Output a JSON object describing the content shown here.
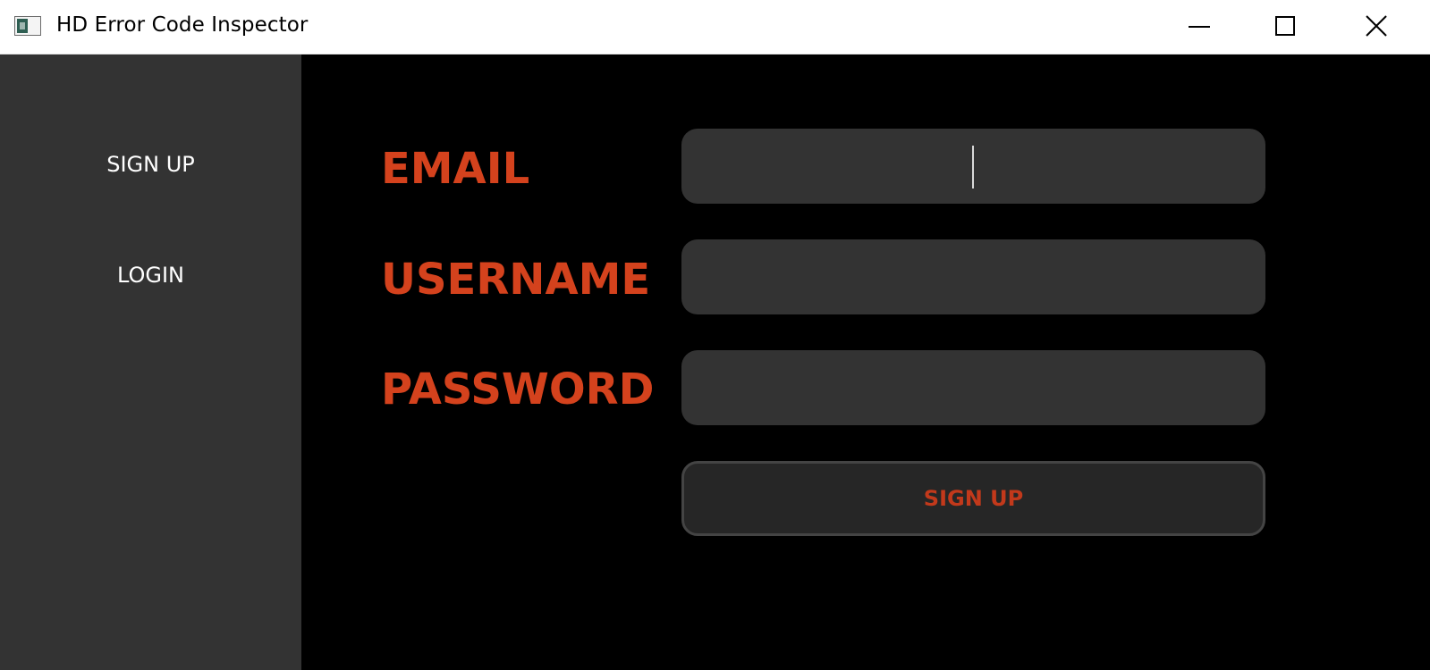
{
  "window": {
    "title": "HD Error Code Inspector",
    "app_icon": "app-window-icon",
    "controls": {
      "minimize_icon": "minimize-icon",
      "maximize_icon": "maximize-icon",
      "close_icon": "close-icon"
    }
  },
  "sidebar": {
    "items": [
      {
        "label": "SIGN UP"
      },
      {
        "label": "LOGIN"
      }
    ]
  },
  "form": {
    "email_label": "EMAIL",
    "username_label": "USERNAME",
    "password_label": "PASSWORD",
    "email_value": "",
    "username_value": "",
    "password_value": "",
    "submit_label": "SIGN UP"
  },
  "colors": {
    "accent": "#d4421d",
    "sidebar_bg": "#333333",
    "main_bg": "#000000",
    "field_bg": "#333333",
    "button_bg": "#262626"
  }
}
